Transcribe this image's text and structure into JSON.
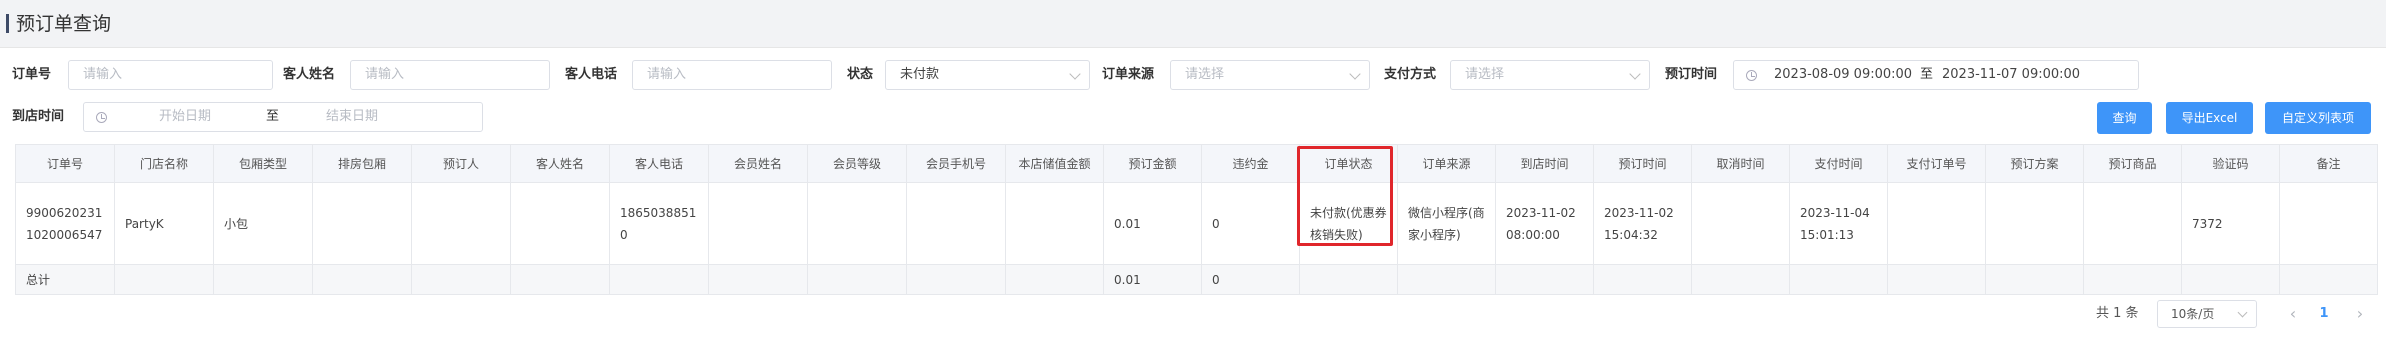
{
  "page": {
    "title": "预订单查询"
  },
  "filters": {
    "order_no": {
      "label": "订单号",
      "placeholder": "请输入"
    },
    "guest_name": {
      "label": "客人姓名",
      "placeholder": "请输入"
    },
    "guest_phone": {
      "label": "客人电话",
      "placeholder": "请输入"
    },
    "status": {
      "label": "状态",
      "value": "未付款"
    },
    "order_source": {
      "label": "订单来源",
      "placeholder": "请选择"
    },
    "pay_method": {
      "label": "支付方式",
      "placeholder": "请选择"
    },
    "booking_time": {
      "label": "预订时间",
      "start": "2023-08-09 09:00:00",
      "separator": "至",
      "end": "2023-11-07 09:00:00"
    },
    "arrival_time": {
      "label": "到店时间",
      "start_placeholder": "开始日期",
      "separator": "至",
      "end_placeholder": "结束日期"
    }
  },
  "actions": {
    "query": "查询",
    "export": "导出Excel",
    "custom_columns": "自定义列表项"
  },
  "table": {
    "columns": [
      "订单号",
      "门店名称",
      "包厢类型",
      "排房包厢",
      "预订人",
      "客人姓名",
      "客人电话",
      "会员姓名",
      "会员等级",
      "会员手机号",
      "本店储值金额",
      "预订金额",
      "违约金",
      "订单状态",
      "订单来源",
      "到店时间",
      "预订时间",
      "取消时间",
      "支付时间",
      "支付订单号",
      "预订方案",
      "预订商品",
      "验证码",
      "备注"
    ],
    "rows": [
      [
        "99006202311020006547",
        "PartyK",
        "小包",
        "",
        "",
        "",
        "18650388510",
        "",
        "",
        "",
        "",
        "0.01",
        "0",
        "未付款(优惠券核销失败)",
        "微信小程序(商家小程序)",
        "2023-11-02 08:00:00",
        "2023-11-02 15:04:32",
        "",
        "2023-11-04 15:01:13",
        "",
        "",
        "",
        "7372",
        ""
      ]
    ],
    "total_row": [
      "总计",
      "",
      "",
      "",
      "",
      "",
      "",
      "",
      "",
      "",
      "",
      "0.01",
      "0",
      "",
      "",
      "",
      "",
      "",
      "",
      "",
      "",
      "",
      "",
      ""
    ]
  },
  "pagination": {
    "total": "共 1 条",
    "page_size": "10条/页",
    "prev": "‹",
    "current": "1",
    "next": "›"
  },
  "colors": {
    "primary": "#3e95f9",
    "highlight": "#e0262b",
    "header_bg": "#f4f6fa",
    "title_bar_bg": "#f2f3f5"
  }
}
